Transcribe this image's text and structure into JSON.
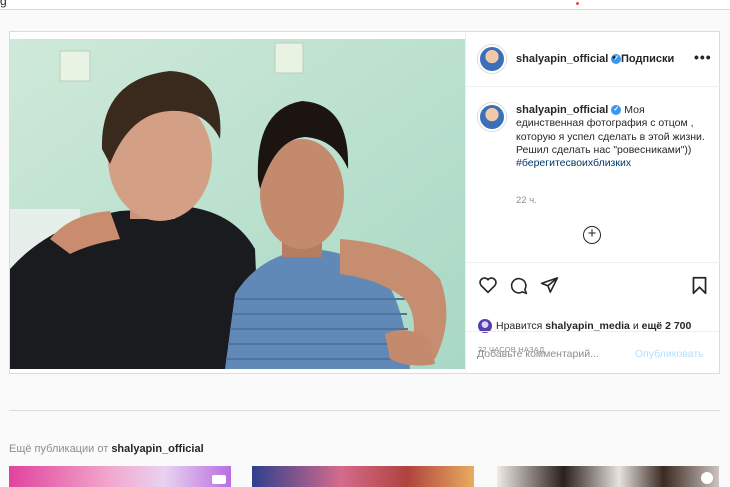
{
  "top_fragment": "g",
  "post": {
    "username": "shalyapin_official",
    "verified_mark": "✓",
    "follow_separator": "•",
    "follow_label": "Подписки",
    "more_label": "•••",
    "caption_text": "Моя единственная фотография с отцом , которую я успел сделать в этой жизни. Решил сделать нас \"ровесниками\"))",
    "hashtag": "#берегитесвоихблизких",
    "caption_time": "22 ч.",
    "add_symbol": "+",
    "likes_prefix": "Нравится",
    "likes_user": "shalyapin_media",
    "likes_middle": "и",
    "likes_count": "ещё 2 700",
    "posted_ago": "22 ЧАСОВ НАЗАД",
    "comment_placeholder": "Добавьте комментарий...",
    "publish_label": "Опубликовать"
  },
  "more_posts": {
    "prefix": "Ещё публикации от",
    "username": "shalyapin_official"
  },
  "icons": [
    "heart-icon",
    "comment-icon",
    "share-icon",
    "bookmark-icon",
    "verified-icon",
    "add-icon"
  ],
  "colors": {
    "accent": "#3897f0",
    "link": "#00376b",
    "muted": "#8e8e8e",
    "publish_disabled": "#b2dffc",
    "notification": "#ed4956"
  }
}
